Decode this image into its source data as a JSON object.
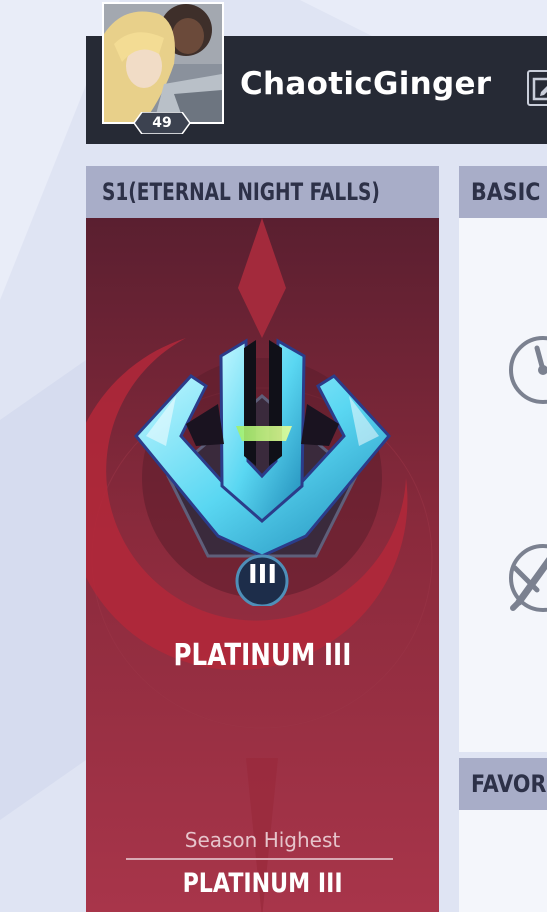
{
  "profile": {
    "username": "ChaoticGinger",
    "level": "49"
  },
  "season": {
    "title": "S1(ETERNAL NIGHT FALLS)",
    "rank_numeral": "III",
    "rank_name": "PLATINUM III",
    "highest_label": "Season Highest",
    "highest_value": "PLATINUM III"
  },
  "stats": {
    "title": "BASIC S"
  },
  "favorites": {
    "title": "FAVORIT"
  },
  "icons": {
    "edit": "edit-icon",
    "speed": "speedometer-icon",
    "sword": "crossed-sword-icon",
    "rank": "platinum-rank-emblem"
  },
  "colors": {
    "page_bg": "#dfe4f3",
    "header_bg": "#262a35",
    "panel_title_bg": "#a8adc8",
    "season_bg": "#8c2438"
  }
}
